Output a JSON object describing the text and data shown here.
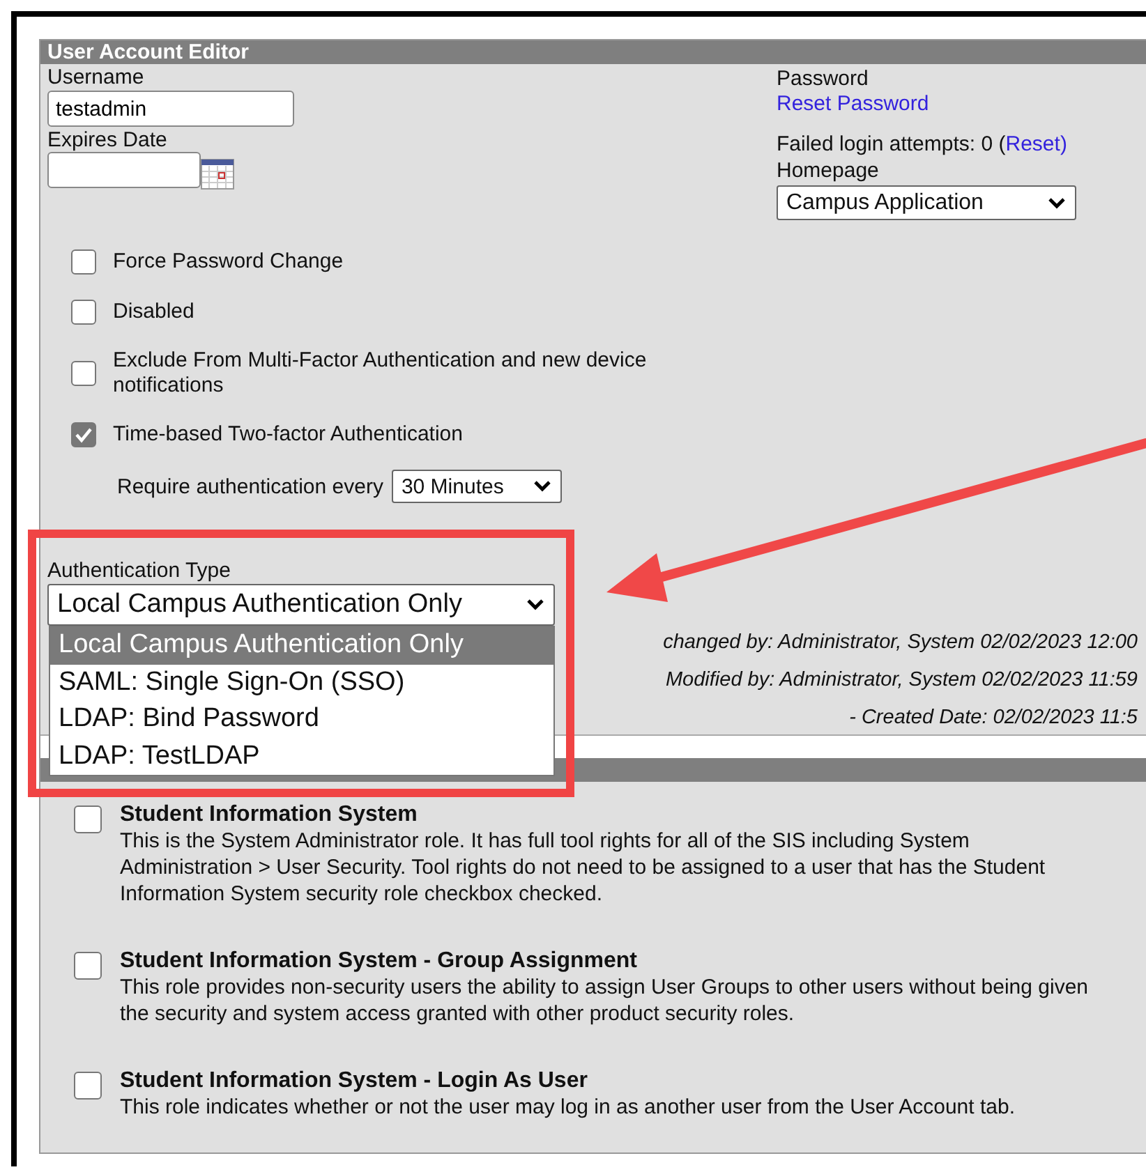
{
  "window": {
    "title": "User Account Editor"
  },
  "username": {
    "label": "Username",
    "value": "testadmin"
  },
  "expires_date": {
    "label": "Expires Date"
  },
  "password": {
    "label": "Password",
    "reset_password": "Reset Password",
    "failed_attempts": "Failed login attempts: 0 (",
    "reset": "Reset",
    "close": ")"
  },
  "homepage": {
    "label": "Homepage",
    "value": "Campus Application"
  },
  "options": [
    {
      "label": "Force Password Change",
      "checked": false
    },
    {
      "label": "Disabled",
      "checked": false
    },
    {
      "label": "Exclude From Multi-Factor Authentication and new device notifications",
      "checked": false
    },
    {
      "label": "Time-based Two-factor Authentication",
      "checked": true
    }
  ],
  "require_authentication": {
    "label": "Require authentication every",
    "value": "30 Minutes"
  },
  "authentication_type": {
    "label": "Authentication Type",
    "value": "Local Campus Authentication Only",
    "expanded": true,
    "options": [
      {
        "label": "Local Campus Authentication Only",
        "selected": true
      },
      {
        "label": "SAML: Single Sign-On (SSO)",
        "selected": false
      },
      {
        "label": "LDAP: Bind Password",
        "selected": false
      },
      {
        "label": "LDAP: TestLDAP",
        "selected": false
      }
    ]
  },
  "history": [
    "changed by: Administrator, System 02/02/2023 12:00",
    "Modified by: Administrator, System 02/02/2023 11:59",
    "- Created Date: 02/02/2023 11:5"
  ],
  "product_security_roles": [
    {
      "title": "Student Information System",
      "description": "This is the System Administrator role. It has full tool rights for all of the SIS including System Administration > User Security. Tool rights do not need to be assigned to a user that has the Student Information System security role checkbox checked.",
      "checked": false
    },
    {
      "title": "Student Information System - Group Assignment",
      "description": "This role provides non-security users the ability to assign User Groups to other users without being given the security and system access granted with other product security roles.",
      "checked": false
    },
    {
      "title": "Student Information System - Login As User",
      "description": "This role indicates whether or not the user may log in as another user from the User Account tab.",
      "checked": false
    }
  ],
  "annotations": [
    {
      "kind": "highlight-box"
    },
    {
      "kind": "arrow"
    }
  ]
}
